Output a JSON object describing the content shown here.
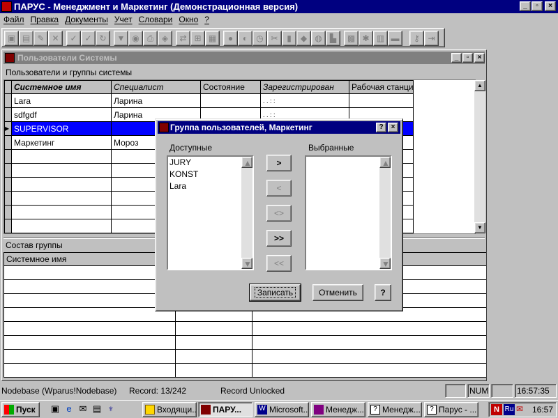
{
  "app": {
    "title": "ПАРУС - Менеджмент и Маркетинг (Демонстрационная версия)"
  },
  "menu": [
    "Файл",
    "Правка",
    "Документы",
    "Учет",
    "Словари",
    "Окно",
    "?"
  ],
  "window_buttons": {
    "min": "_",
    "max": "□",
    "close": "×"
  },
  "child": {
    "title": "Пользователи Системы"
  },
  "users_section": "Пользователи и группы системы",
  "users_table": {
    "columns": [
      "Системное имя",
      "Специалист",
      "Состояние",
      "Зарегистрирован",
      "Рабочая станци"
    ],
    "rows": [
      [
        "Lara",
        "Ларина",
        "",
        ". .     : :",
        ""
      ],
      [
        "sdfgdf",
        "Ларина",
        "",
        ". .     : :",
        ""
      ],
      [
        "SUPERVISOR",
        "",
        "",
        "",
        ""
      ],
      [
        "Маркетинг",
        "Мороз",
        "",
        "",
        ""
      ]
    ]
  },
  "group_section": "Состав группы",
  "group_table": {
    "columns": [
      "Системное имя"
    ]
  },
  "dialog": {
    "title": "Группа пользователей, Маркетинг",
    "available_label": "Доступные",
    "selected_label": "Выбранные",
    "available": [
      "JURY",
      "KONST",
      "Lara"
    ],
    "selected": [],
    "btn_add": ">",
    "btn_remove": "<",
    "btn_swap": "<>",
    "btn_add_all": ">>",
    "btn_remove_all": "<<",
    "save": "Записать",
    "cancel": "Отменить",
    "help": "?"
  },
  "status": {
    "db": "Nodebase (Wparus!Nodebase)",
    "record": "Record: 13/242",
    "lock": "Record Unlocked",
    "num": "NUM",
    "time": "16:57:35"
  },
  "taskbar": {
    "start": "Пуск",
    "tasks": [
      "Входящи...",
      "ПАРУ...",
      "Microsoft...",
      "Менедж...",
      "Менедж...",
      "Парус - ..."
    ],
    "lang": "Ru",
    "clock": "16:57"
  }
}
